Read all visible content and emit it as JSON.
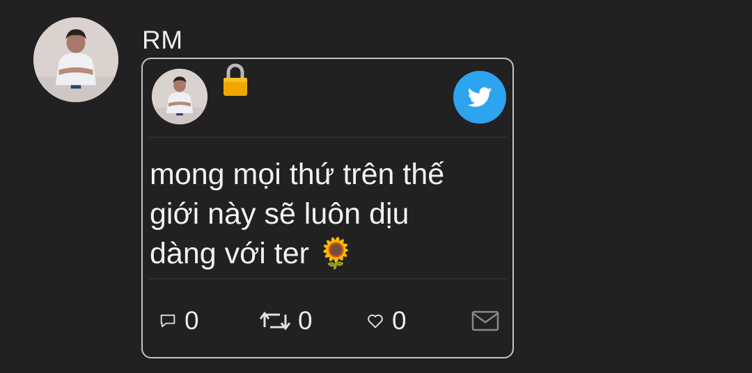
{
  "author": {
    "name": "RM"
  },
  "card": {
    "lock_icon": "lock-icon",
    "platform_icon": "twitter-bird-icon",
    "colors": {
      "badge": "#2ea3ef",
      "border": "#c4c4c4",
      "background": "#212121"
    },
    "text": "mong mọi thứ trên thế\ngiới này sẽ luôn dịu\ndàng với ter 🌻",
    "actions": {
      "reply_count": "0",
      "retweet_count": "0",
      "like_count": "0",
      "reply_icon": "comment-icon",
      "retweet_icon": "retweet-icon",
      "like_icon": "heart-icon",
      "dm_icon": "envelope-icon"
    }
  }
}
